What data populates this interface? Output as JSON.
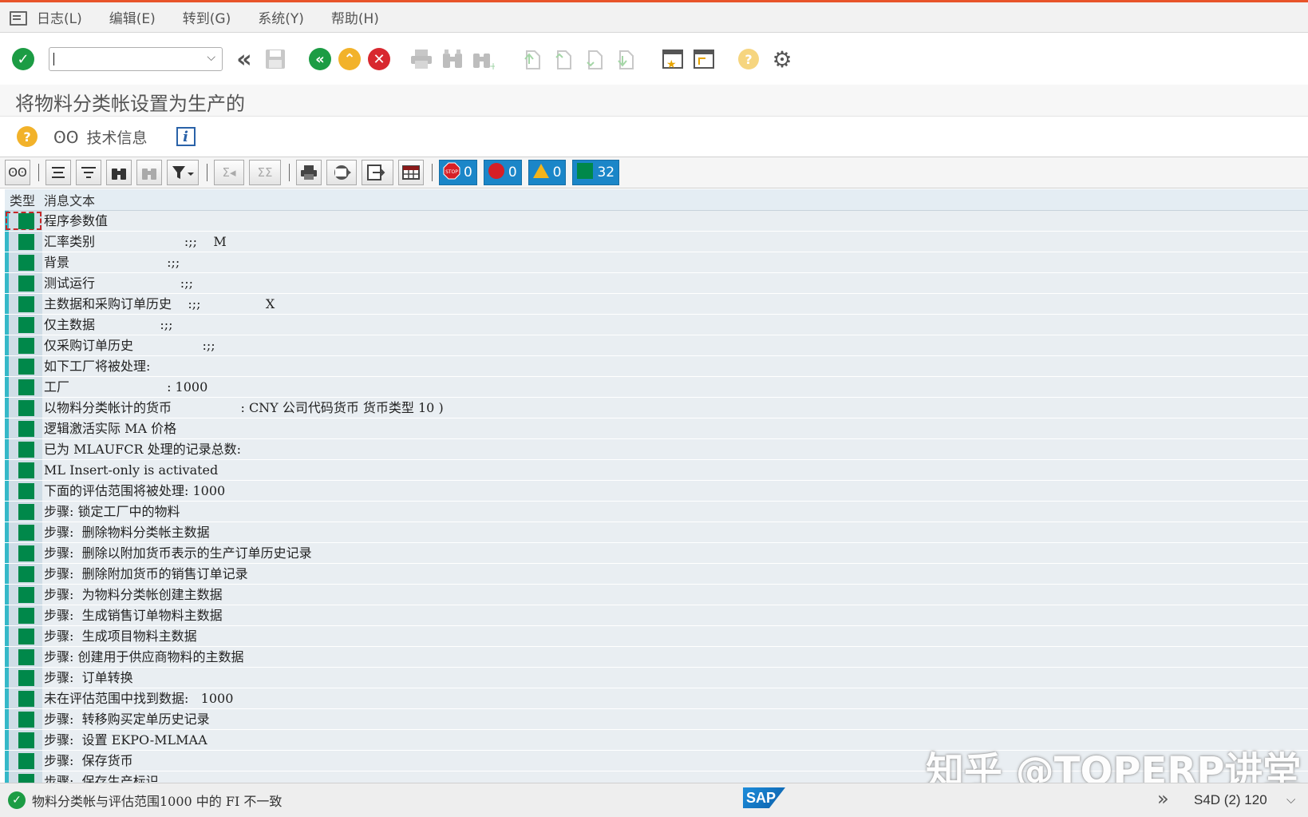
{
  "menu": {
    "items": [
      "日志(L)",
      "编辑(E)",
      "转到(G)",
      "系统(Y)",
      "帮助(H)"
    ]
  },
  "toolbar": {
    "command_value": "",
    "icons": [
      "enter-icon",
      "back-icon",
      "save-icon",
      "back-green-icon",
      "exit-icon",
      "cancel-icon",
      "print-icon",
      "find-icon",
      "find-next-icon",
      "first-page-icon",
      "previous-page-icon",
      "next-page-icon",
      "last-page-icon",
      "create-session-icon",
      "shortcut-icon",
      "help-icon",
      "settings-icon"
    ]
  },
  "title": "将物料分类帐设置为生产的",
  "app_toolbar": {
    "tech_info_label": "技术信息",
    "info_label": "i"
  },
  "alv_toolbar": {
    "counters": [
      {
        "icon": "stop-icon",
        "value": "0"
      },
      {
        "icon": "error-icon",
        "value": "0"
      },
      {
        "icon": "warning-icon",
        "value": "0"
      },
      {
        "icon": "success-icon",
        "value": "32"
      }
    ]
  },
  "grid": {
    "headers": {
      "type": "类型",
      "text": "消息文本"
    },
    "rows": [
      "程序参数值",
      "汇率类别                      :;;    M",
      "背景                        :;;",
      "测试运行                     :;;",
      "主数据和采购订单历史    :;;                X",
      "仅主数据                :;;",
      "仅采购订单历史                 :;;",
      "如下工厂将被处理:",
      "工厂                        : 1000",
      "以物料分类帐计的货币                 : CNY 公司代码货币 货币类型 10 )",
      "逻辑激活实际 MA 价格",
      "已为 MLAUFCR 处理的记录总数:",
      "ML Insert-only is activated",
      "下面的评估范围将被处理: 1000",
      "步骤: 锁定工厂中的物料",
      "步骤:  删除物料分类帐主数据",
      "步骤:  删除以附加货币表示的生产订单历史记录",
      "步骤:  删除附加货币的销售订单记录",
      "步骤:  为物料分类帐创建主数据",
      "步骤:  生成销售订单物料主数据",
      "步骤:  生成项目物料主数据",
      "步骤: 创建用于供应商物料的主数据",
      "步骤:  订单转换",
      "未在评估范围中找到数据:   1000",
      "步骤:  转移购买定单历史记录",
      "步骤:  设置 EKPO-MLMAA",
      "步骤:  保存货币",
      "步骤:  保存生产标识"
    ]
  },
  "status": {
    "message": "物料分类帐与评估范围1000 中的 FI 不一致",
    "logo": "SAP",
    "system": "S4D (2) 120"
  },
  "watermark": "知乎 @TOPERP讲堂",
  "colors": {
    "success_green": "#00884a",
    "accent_orange": "#e8542a",
    "counter_blue": "#1b86c8"
  }
}
